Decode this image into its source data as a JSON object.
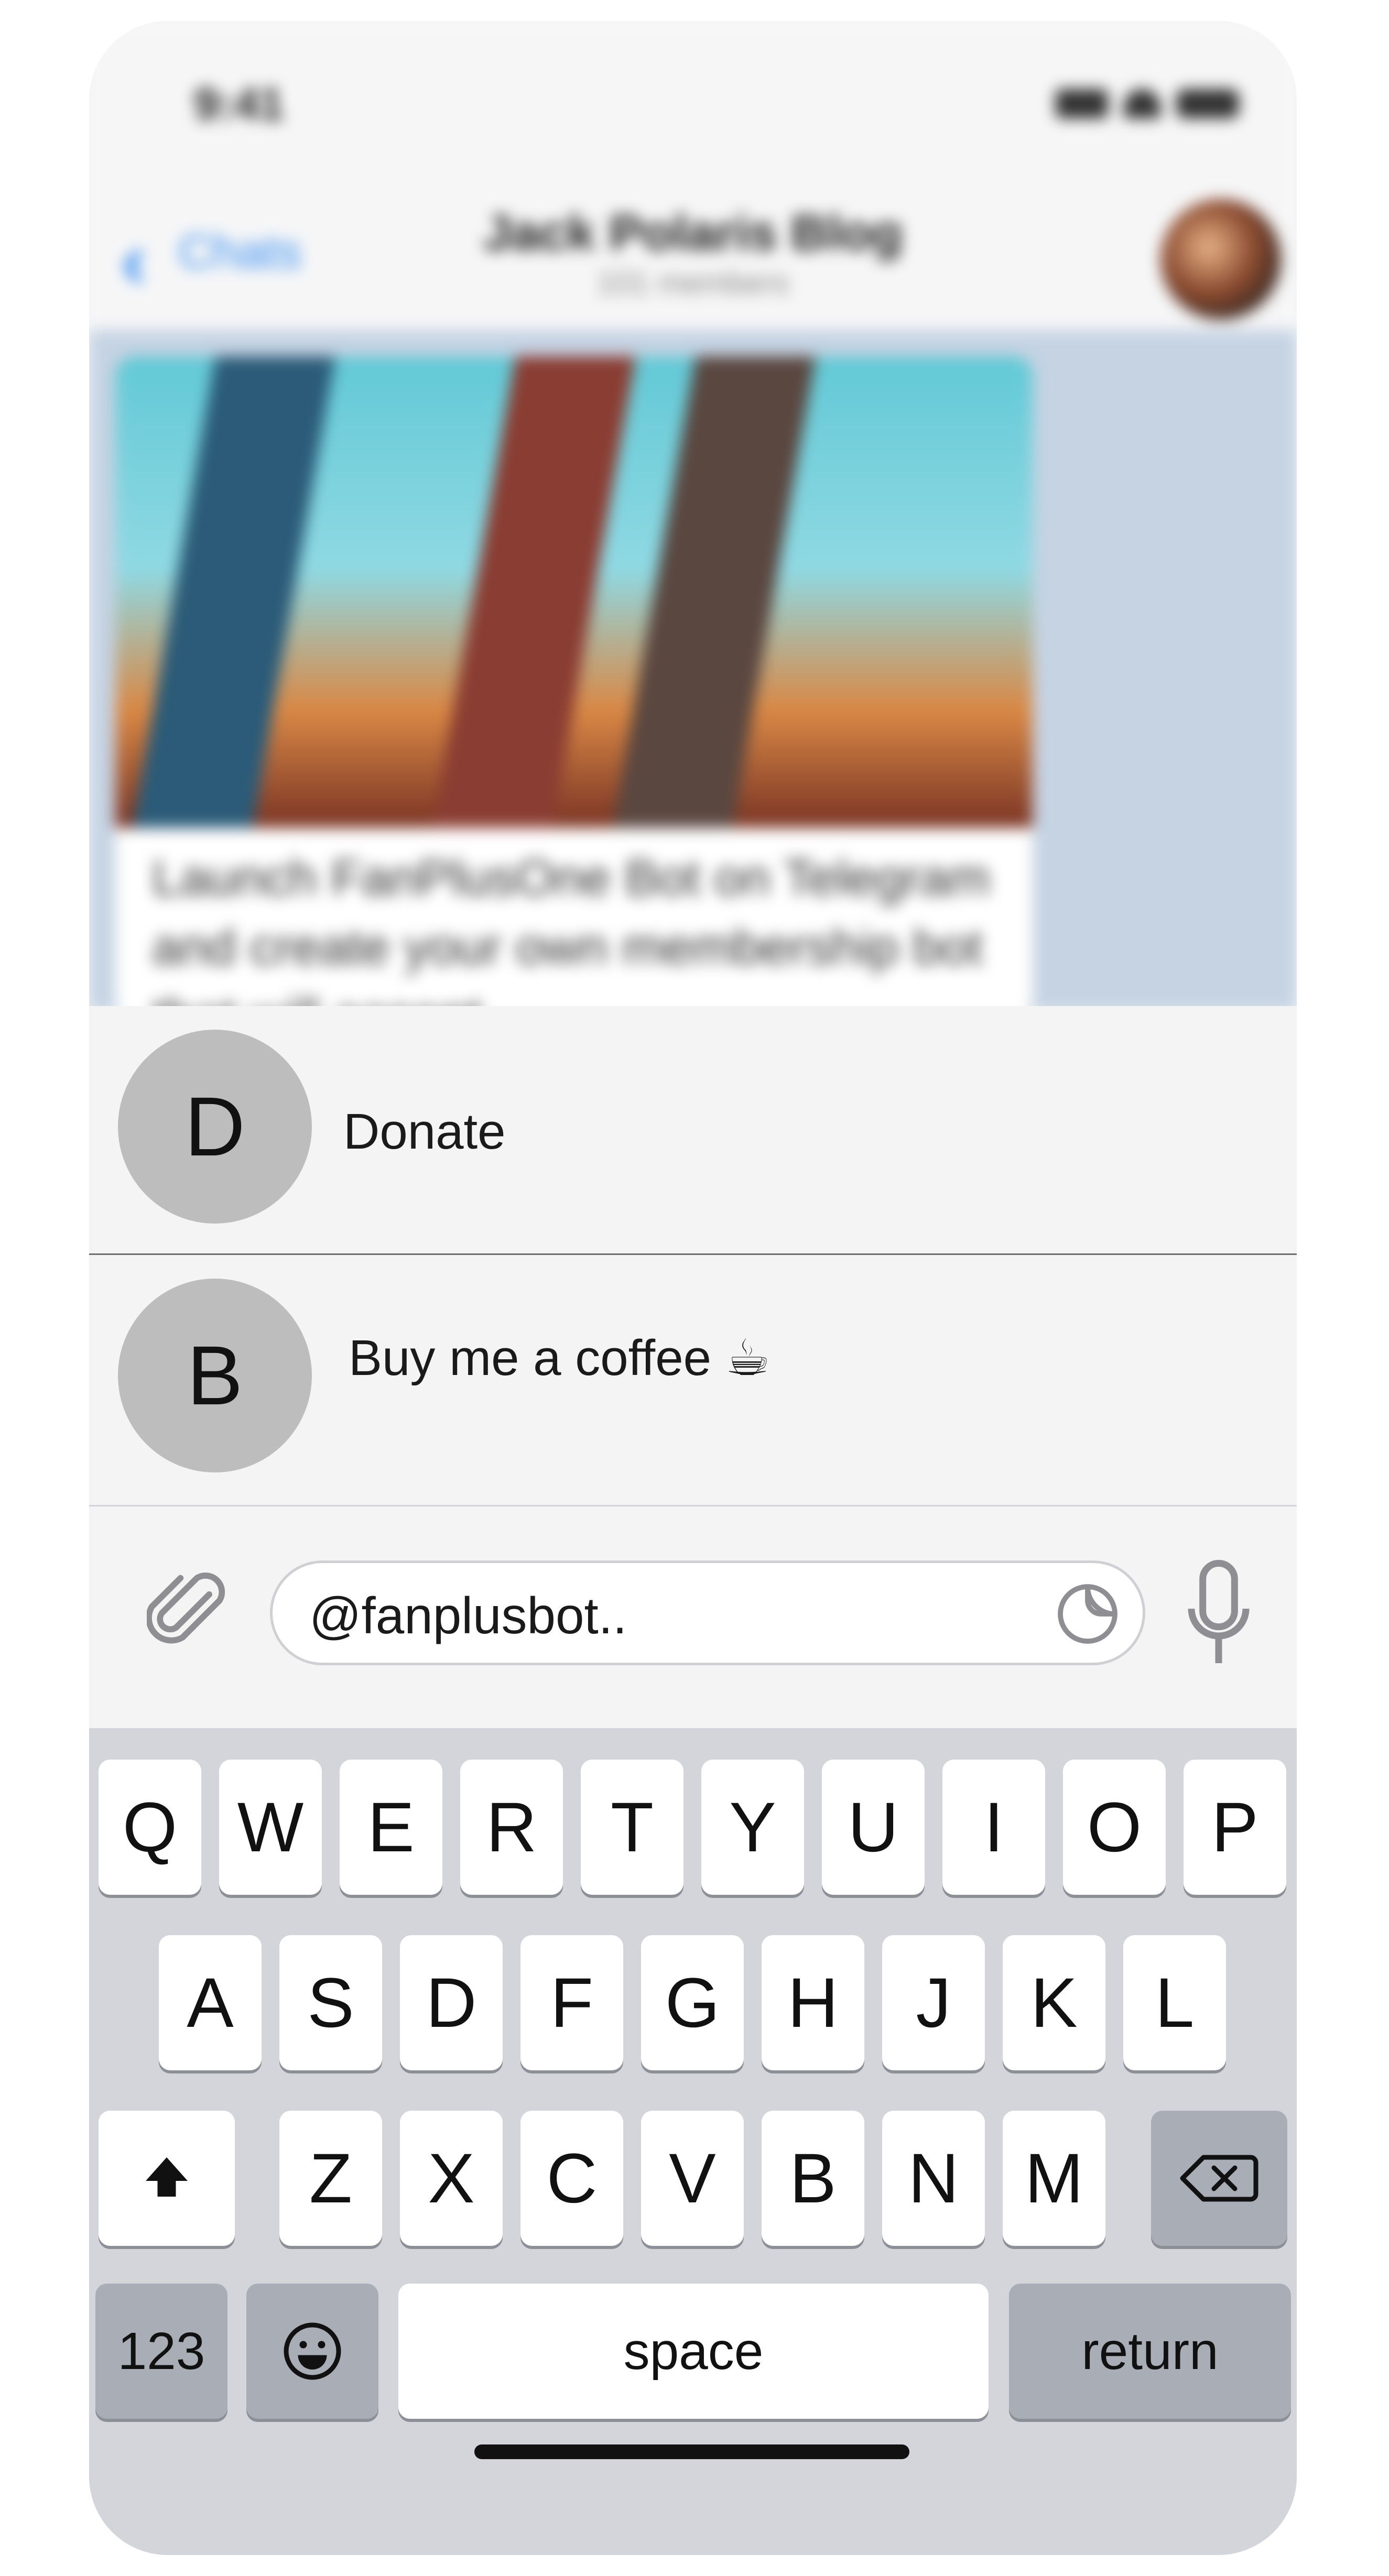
{
  "status_bar": {
    "time": "9:41"
  },
  "nav": {
    "back_label": "Chats",
    "title": "Jack Polaris Blog",
    "subtitle": "101 members"
  },
  "message": {
    "text": "Launch FanPlusOne Bot on Telegram and create your own membership bot that will accept"
  },
  "suggestions": [
    {
      "initial": "D",
      "label": "Donate"
    },
    {
      "initial": "B",
      "label": "Buy me a coffee ☕"
    }
  ],
  "input": {
    "value": "@fanplusbot.."
  },
  "icons": {
    "attach": "paperclip-icon",
    "sticker": "sticker-icon",
    "mic": "microphone-icon",
    "shift": "shift-icon",
    "delete": "backspace-icon",
    "emoji": "emoji-icon"
  },
  "keyboard": {
    "row1": [
      "Q",
      "W",
      "E",
      "R",
      "T",
      "Y",
      "U",
      "I",
      "O",
      "P"
    ],
    "row2": [
      "A",
      "S",
      "D",
      "F",
      "G",
      "H",
      "J",
      "K",
      "L"
    ],
    "row3": [
      "Z",
      "X",
      "C",
      "V",
      "B",
      "N",
      "M"
    ],
    "numbers_label": "123",
    "space_label": "space",
    "return_label": "return"
  },
  "colors": {
    "accent": "#3a8ff0",
    "suggestion_avatar": "#bdbdbd",
    "keyboard_bg": "#d3d5db",
    "key_dark": "#a9adb6"
  }
}
